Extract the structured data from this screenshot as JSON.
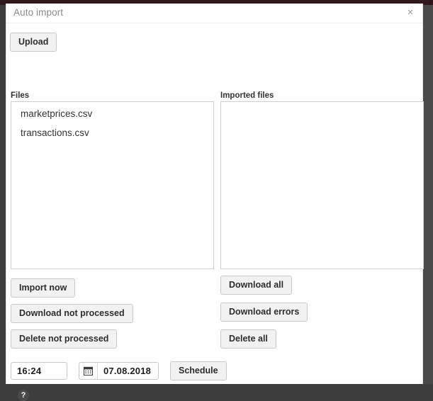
{
  "window": {
    "title": "Auto import",
    "close_label": "×"
  },
  "toolbar": {
    "upload_label": "Upload"
  },
  "columns": {
    "files_label": "Files",
    "imported_label": "Imported files"
  },
  "files_list": {
    "items": [
      {
        "name": "marketprices.csv"
      },
      {
        "name": "transactions.csv"
      }
    ]
  },
  "imported_list": {
    "items": []
  },
  "left_actions": {
    "import_now_label": "Import now",
    "download_not_processed_label": "Download not processed",
    "delete_not_processed_label": "Delete not processed"
  },
  "right_actions": {
    "download_all_label": "Download all",
    "download_errors_label": "Download errors",
    "delete_all_label": "Delete all"
  },
  "schedule": {
    "time_value": "16:24",
    "time_placeholder": "hh:mm",
    "date_value": "07.08.2018",
    "date_placeholder": "dd.mm.yyyy",
    "calendar_icon": "calendar-icon",
    "schedule_label": "Schedule"
  },
  "help": {
    "glyph": "?",
    "icon": "help-icon"
  },
  "colors": {
    "top_bar": "#32191e",
    "sidebar": "#3d3d3d",
    "modal_bg": "#ffffff",
    "button_bg": "#f2f2f2",
    "button_border": "#c9c9c9",
    "title_text": "#8a8a8a",
    "body_text": "#333333"
  }
}
